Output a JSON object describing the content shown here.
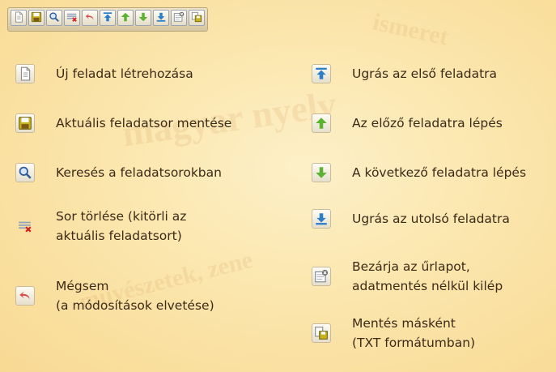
{
  "toolbar": {
    "buttons": [
      {
        "icon": "new-document-icon"
      },
      {
        "icon": "save-icon"
      },
      {
        "icon": "search-icon"
      },
      {
        "icon": "delete-row-icon"
      },
      {
        "icon": "undo-icon"
      },
      {
        "icon": "go-first-icon"
      },
      {
        "icon": "go-previous-icon"
      },
      {
        "icon": "go-next-icon"
      },
      {
        "icon": "go-last-icon"
      },
      {
        "icon": "close-form-icon"
      },
      {
        "icon": "save-as-icon"
      }
    ]
  },
  "legend": {
    "left": [
      {
        "icon": "new-document-icon",
        "lines": [
          "Új feladat létrehozása"
        ]
      },
      {
        "icon": "save-icon",
        "lines": [
          "Aktuális feladatsor mentése"
        ]
      },
      {
        "icon": "search-icon",
        "lines": [
          "Keresés a feladatsorokban"
        ]
      },
      {
        "icon": "delete-row-icon",
        "lines": [
          "Sor törlése (kitörli az",
          "aktuális feladatsort)"
        ]
      },
      {
        "icon": "undo-icon",
        "lines": [
          "Mégsem",
          "(a módosítások elvetése)"
        ]
      }
    ],
    "right": [
      {
        "icon": "go-first-icon",
        "lines": [
          "Ugrás az első feladatra"
        ]
      },
      {
        "icon": "go-previous-icon",
        "lines": [
          "Az előző feladatra lépés"
        ]
      },
      {
        "icon": "go-next-icon",
        "lines": [
          "A következő feladatra lépés"
        ]
      },
      {
        "icon": "go-last-icon",
        "lines": [
          "Ugrás az utolsó feladatra"
        ]
      },
      {
        "icon": "close-form-icon",
        "lines": [
          "Bezárja az űrlapot,",
          "adatmentés nélkül kilép"
        ]
      },
      {
        "icon": "save-as-icon",
        "lines": [
          "Mentés másként",
          "(TXT formátumban)"
        ]
      }
    ]
  },
  "watermark": [
    "magyar nyelv",
    "művészetek, zene",
    "ismeret"
  ]
}
